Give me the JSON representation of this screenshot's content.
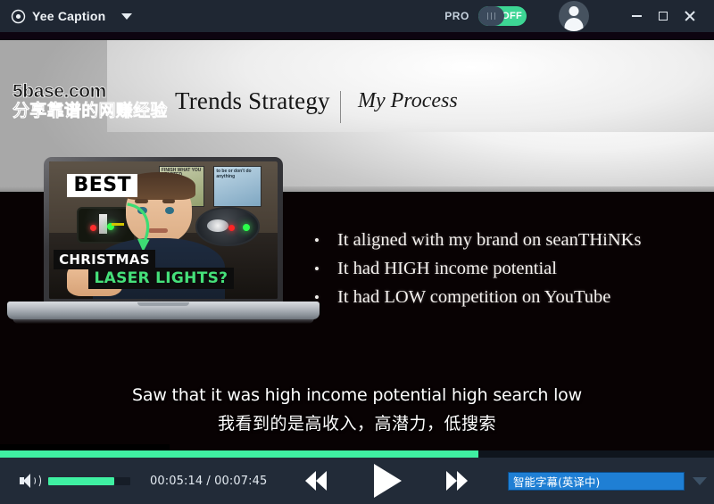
{
  "titlebar": {
    "app_icon": "record-circle-icon",
    "app_name": "Yee Caption",
    "dropdown_icon": "chevron-down-icon",
    "pro_label": "PRO",
    "pro_toggle_state": "OFF",
    "avatar_icon": "user-avatar-icon",
    "minimize_icon": "minimize-icon",
    "maximize_icon": "maximize-icon",
    "close_icon": "close-icon",
    "bg_color": "#1f2733",
    "accent_color": "#3dd694"
  },
  "video": {
    "watermark": {
      "line1": "5base.com",
      "line2": "分享靠谱的网赚经验"
    },
    "slide": {
      "title": "Trends Strategy",
      "subtitle": "My Process",
      "bullet_glyph": "•",
      "bullets": [
        "It aligned with my brand on seanTHiNKs",
        "It had HIGH income potential",
        "It had LOW competition on YouTube"
      ]
    },
    "thumbnail": {
      "tag_best": "BEST",
      "tag_christmas": "CHRISTMAS",
      "tag_laser": "LASER LIGHTS?",
      "poster_left_text": "FINISH WHAT YOU STARTED",
      "poster_right_text": "to be or don't do anything",
      "laser_green": "#35ff4e",
      "laser_red": "#ff2d2d",
      "laser_text_color": "#45e07a"
    },
    "captions": {
      "english": "Saw that it was high income potential high search low",
      "chinese": "我看到的是高收入，高潜力，低搜索"
    }
  },
  "player": {
    "progress_percent": 67,
    "progress_color": "#3ff0a2",
    "volume_icon": "volume-icon",
    "volume_percent": 80,
    "time_current": "00:05:14",
    "time_separator": " / ",
    "time_total": "00:07:45",
    "time_display": "00:05:14 / 00:07:45",
    "rewind_icon": "rewind-icon",
    "play_icon": "play-icon",
    "forward_icon": "fast-forward-icon",
    "subtitle_select_value": "智能字幕(英译中)",
    "subtitle_select_caret": "chevron-down-icon",
    "select_bg_color": "#1f7fd4",
    "bar_bg_color": "#222b38"
  }
}
